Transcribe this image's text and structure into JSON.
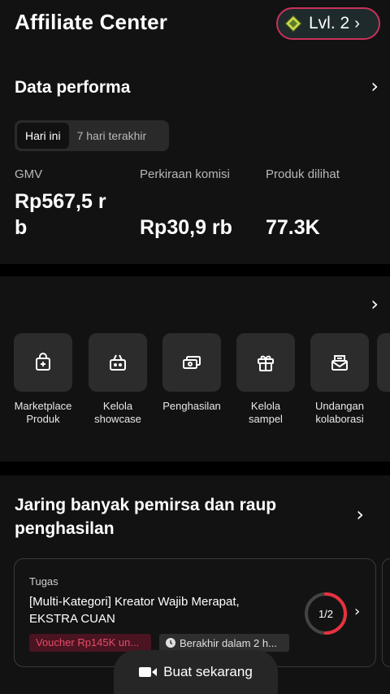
{
  "header": {
    "title": "Affiliate Center",
    "level_label": "Lvl. 2",
    "gem_color": "#c9d84a"
  },
  "performance": {
    "title": "Data performa",
    "periods": [
      "Hari ini",
      "7 hari terakhir"
    ],
    "selected_period": "Hari ini",
    "metrics": [
      {
        "label": "GMV",
        "value_line1": "Rp567,5 r",
        "value_line2": "b"
      },
      {
        "label": "Perkiraan komisi",
        "value": "Rp30,9 rb"
      },
      {
        "label": "Produk dilihat",
        "value": "77.3K"
      }
    ]
  },
  "tools": {
    "items": [
      {
        "line1": "Marketplace",
        "line2": "Produk",
        "icon": "marketplace-bag-icon"
      },
      {
        "line1": "Kelola",
        "line2": "showcase",
        "icon": "shopping-basket-icon"
      },
      {
        "line1": "Penghasilan",
        "line2": "",
        "icon": "money-cards-icon"
      },
      {
        "line1": "Kelola",
        "line2": "sampel",
        "icon": "gift-icon"
      },
      {
        "line1": "Undangan",
        "line2": "kolaborasi",
        "icon": "envelope-icon"
      }
    ]
  },
  "earn": {
    "title": "Jaring banyak pemirsa dan raup penghasilan",
    "task": {
      "kind": "Tugas",
      "title": "[Multi-Kategori] Kreator Wajib Merapat, EKSTRA CUAN",
      "voucher": "Voucher Rp145K un...",
      "deadline": "Berakhir dalam 2 h...",
      "progress_text": "1/2",
      "progress_fraction": 0.5,
      "accent": "#e8313f"
    }
  },
  "cta": {
    "label": "Buat sekarang"
  }
}
